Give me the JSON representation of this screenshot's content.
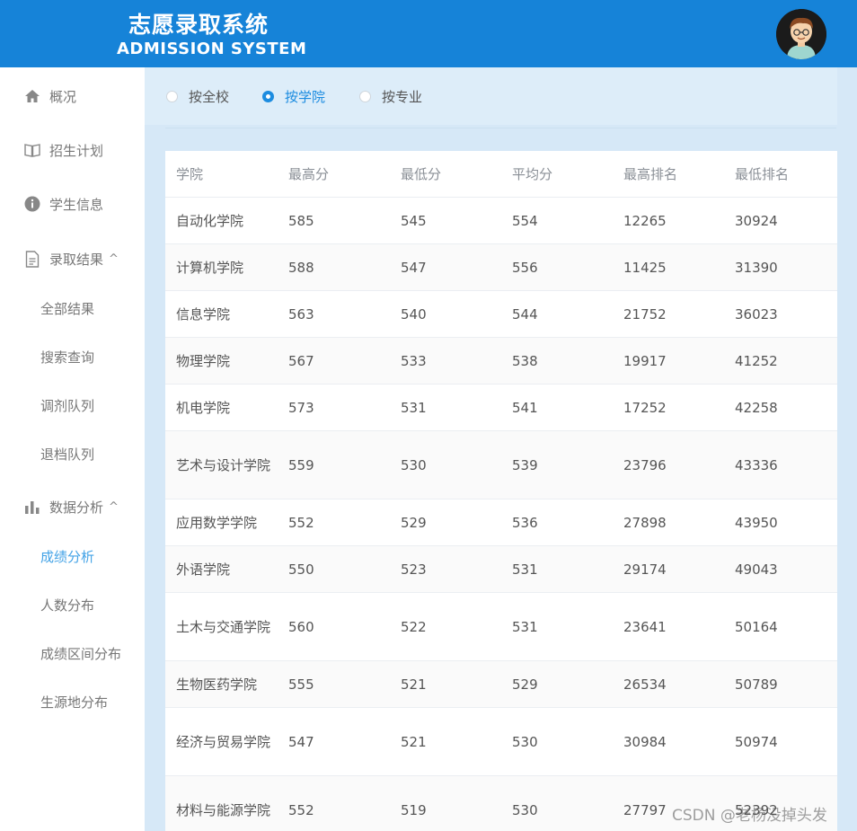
{
  "header": {
    "title_cn": "志愿录取系统",
    "title_en": "ADMISSION SYSTEM",
    "avatar_icon": "user-avatar-icon"
  },
  "sidebar": {
    "items": [
      {
        "label": "概况",
        "icon": "home-icon"
      },
      {
        "label": "招生计划",
        "icon": "book-icon"
      },
      {
        "label": "学生信息",
        "icon": "info-icon"
      },
      {
        "label": "录取结果",
        "icon": "document-icon",
        "chevron": "^"
      },
      {
        "label": "数据分析",
        "icon": "bar-chart-icon",
        "chevron": "^"
      }
    ],
    "admission_sub": [
      "全部结果",
      "搜索查询",
      "调剂队列",
      "退档队列"
    ],
    "analysis_sub": [
      "成绩分析",
      "人数分布",
      "成绩区间分布",
      "生源地分布"
    ],
    "active_sub": "成绩分析",
    "active_color": "#42a2e6"
  },
  "filters": {
    "options": [
      "按全校",
      "按学院",
      "按专业"
    ],
    "selected": "按学院",
    "accent": "#1c8ce0"
  },
  "table": {
    "headers": [
      "学院",
      "最高分",
      "最低分",
      "平均分",
      "最高排名",
      "最低排名"
    ],
    "rows": [
      [
        "自动化学院",
        "585",
        "545",
        "554",
        "12265",
        "30924"
      ],
      [
        "计算机学院",
        "588",
        "547",
        "556",
        "11425",
        "31390"
      ],
      [
        "信息学院",
        "563",
        "540",
        "544",
        "21752",
        "36023"
      ],
      [
        "物理学院",
        "567",
        "533",
        "538",
        "19917",
        "41252"
      ],
      [
        "机电学院",
        "573",
        "531",
        "541",
        "17252",
        "42258"
      ],
      [
        "艺术与设计学院",
        "559",
        "530",
        "539",
        "23796",
        "43336"
      ],
      [
        "应用数学学院",
        "552",
        "529",
        "536",
        "27898",
        "43950"
      ],
      [
        "外语学院",
        "550",
        "523",
        "531",
        "29174",
        "49043"
      ],
      [
        "土木与交通学院",
        "560",
        "522",
        "531",
        "23641",
        "50164"
      ],
      [
        "生物医药学院",
        "555",
        "521",
        "529",
        "26534",
        "50789"
      ],
      [
        "经济与贸易学院",
        "547",
        "521",
        "530",
        "30984",
        "50974"
      ],
      [
        "材料与能源学院",
        "552",
        "519",
        "530",
        "27797",
        "52392"
      ]
    ]
  },
  "watermark": "CSDN @老杨没掉头发",
  "colors": {
    "header_bg": "#1683d8",
    "main_bg": "#d6e8f7"
  }
}
